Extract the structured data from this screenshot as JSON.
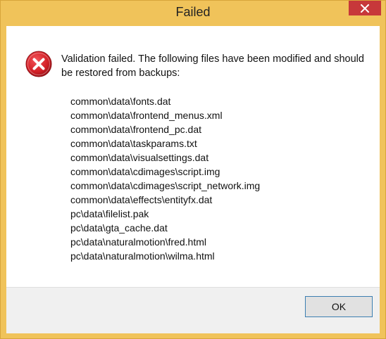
{
  "window": {
    "title": "Failed"
  },
  "icons": {
    "dialog_icon": "error-icon",
    "close_icon": "close-icon"
  },
  "colors": {
    "title_bar": "#f0c35a",
    "close_button": "#c7383a",
    "error_icon": "#d21f26",
    "footer": "#f0f0f0",
    "ok_border": "#3c7fb1"
  },
  "dialog": {
    "message": "Validation failed. The following files have been modified and should be restored from backups:",
    "files": [
      "common\\data\\fonts.dat",
      "common\\data\\frontend_menus.xml",
      "common\\data\\frontend_pc.dat",
      "common\\data\\taskparams.txt",
      "common\\data\\visualsettings.dat",
      "common\\data\\cdimages\\script.img",
      "common\\data\\cdimages\\script_network.img",
      "common\\data\\effects\\entityfx.dat",
      "pc\\data\\filelist.pak",
      "pc\\data\\gta_cache.dat",
      "pc\\data\\naturalmotion\\fred.html",
      "pc\\data\\naturalmotion\\wilma.html"
    ],
    "ok_label": "OK"
  }
}
